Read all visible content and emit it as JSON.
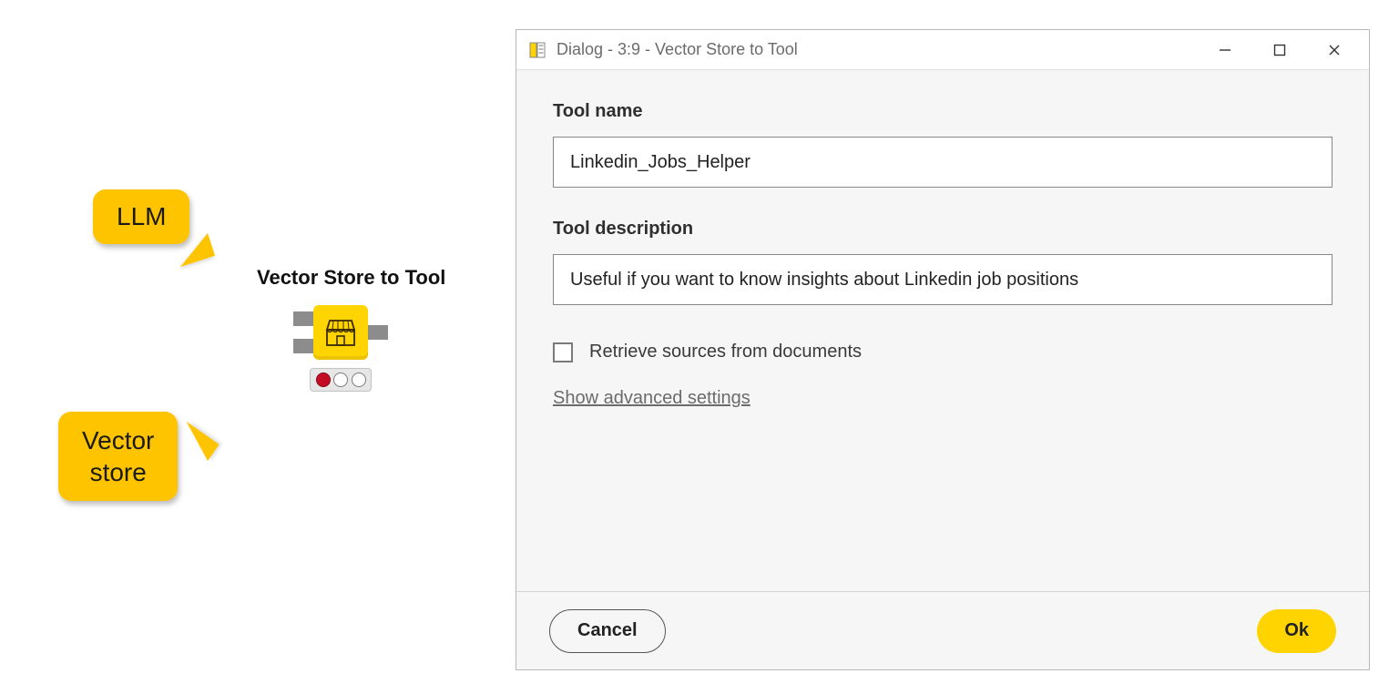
{
  "callouts": {
    "llm": "LLM",
    "vector_store_line1": "Vector",
    "vector_store_line2": "store"
  },
  "node": {
    "title": "Vector Store to Tool"
  },
  "dialog": {
    "title": "Dialog - 3:9 - Vector Store to Tool",
    "fields": {
      "tool_name_label": "Tool name",
      "tool_name_value": "Linkedin_Jobs_Helper",
      "tool_desc_label": "Tool description",
      "tool_desc_value": "Useful if you want to know insights about Linkedin job positions",
      "retrieve_sources_label": "Retrieve sources from documents",
      "retrieve_sources_checked": false,
      "advanced_link": "Show advanced settings"
    },
    "buttons": {
      "cancel": "Cancel",
      "ok": "Ok"
    }
  }
}
